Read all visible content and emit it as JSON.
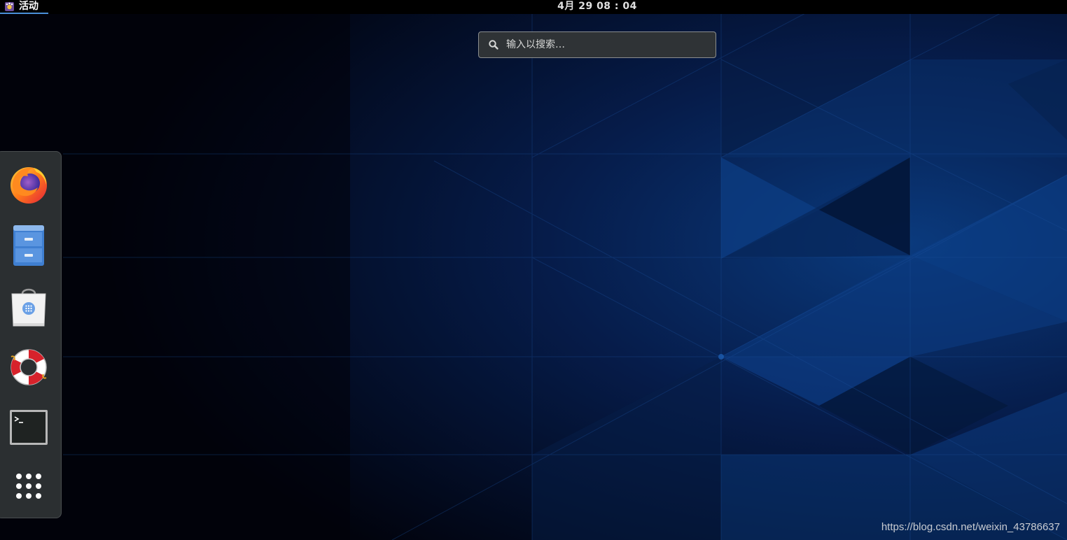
{
  "topbar": {
    "activities_label": "活动",
    "activities_icon": "gnome-foot-icon",
    "clock": "4月 29  08 : 04"
  },
  "search": {
    "icon": "search-icon",
    "placeholder": "输入以搜索…"
  },
  "dash": {
    "items": [
      {
        "name": "firefox",
        "icon": "firefox-icon"
      },
      {
        "name": "files",
        "icon": "file-cabinet-icon"
      },
      {
        "name": "software",
        "icon": "software-bag-icon"
      },
      {
        "name": "help",
        "icon": "lifebuoy-icon"
      },
      {
        "name": "terminal",
        "icon": "terminal-icon"
      },
      {
        "name": "show-applications",
        "icon": "app-grid-icon"
      }
    ]
  },
  "watermark": "https://blog.csdn.net/weixin_43786637",
  "colors": {
    "topbar_bg": "#000000",
    "accent": "#4a90d9",
    "dash_bg": "#2b2f31",
    "search_bg": "#2f3336"
  }
}
